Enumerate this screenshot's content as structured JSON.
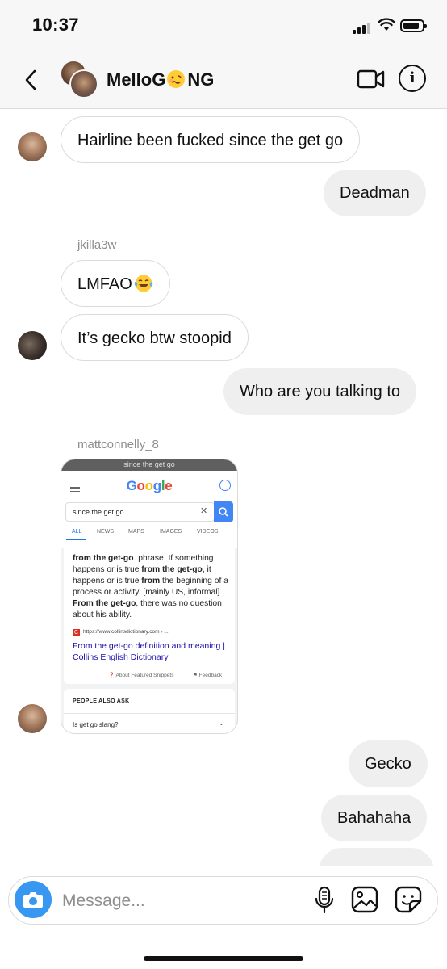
{
  "status": {
    "time": "10:37"
  },
  "header": {
    "title_prefix": "MelloG",
    "title_suffix": "NG"
  },
  "messages": [
    {
      "text": "Hairline been fucked since the get go"
    },
    {
      "text": "Deadman"
    },
    {
      "sender": "jkilla3w",
      "text": "LMFAO"
    },
    {
      "text": "It’s gecko btw stoopid"
    },
    {
      "text": "Who are you talking to"
    },
    {
      "sender": "mattconnelly_8"
    },
    {
      "text": "Gecko"
    },
    {
      "text": "Bahahaha"
    }
  ],
  "shared_screenshot": {
    "top_text": "since the get go",
    "logo": "Google",
    "search_query": "since the get go",
    "tabs": [
      "ALL",
      "NEWS",
      "MAPS",
      "IMAGES",
      "VIDEOS"
    ],
    "definition": {
      "p1": "from the get-go",
      "p2": ". phrase. If something happens or is true ",
      "p3": "from the get-go",
      "p4": ", it happens or is true ",
      "p5": "from",
      "p6": " the beginning of a process or activity. [mainly US, informal] ",
      "p7": "From the get-go",
      "p8": ", there was no question about his ability."
    },
    "source_url": "https://www.collinsdictionary.com › ...",
    "link_text": "From the get-go definition and meaning | Collins English Dictionary",
    "about": "About Featured Snippets",
    "feedback": "Feedback",
    "people_also_ask": "PEOPLE ALSO ASK",
    "question": "Is get go slang?"
  },
  "composer": {
    "placeholder": "Message..."
  },
  "colors": {
    "accent": "#3897f0",
    "sent_bubble": "#efefef",
    "received_border": "#dbdbdb"
  }
}
